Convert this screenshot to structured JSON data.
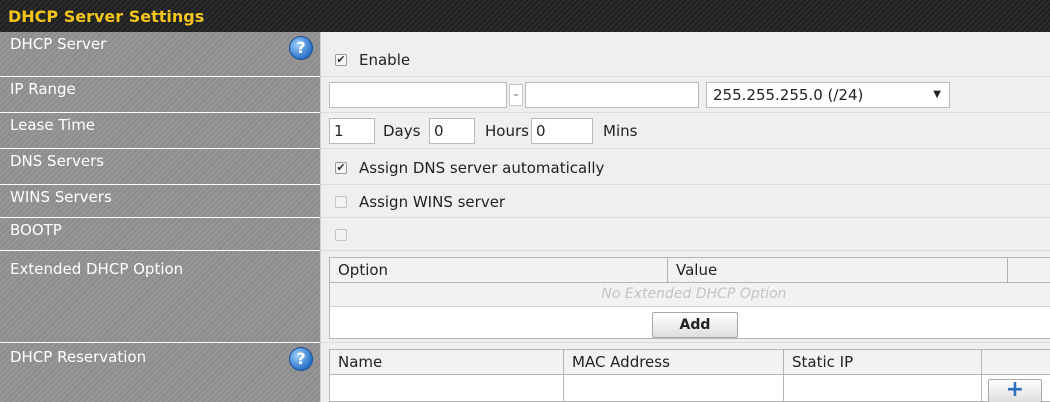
{
  "section": {
    "title": "DHCP Server Settings"
  },
  "rows": {
    "dhcp_server": {
      "label": "DHCP Server",
      "checkbox_label": "Enable",
      "checked": true,
      "help": "?"
    },
    "ip_range": {
      "label": "IP Range",
      "start_value": "",
      "end_value": "",
      "separator": "-",
      "subnet": "255.255.255.0 (/24)"
    },
    "lease_time": {
      "label": "Lease Time",
      "days": "1",
      "days_label": "Days",
      "hours": "0",
      "hours_label": "Hours",
      "mins": "0",
      "mins_label": "Mins"
    },
    "dns_servers": {
      "label": "DNS Servers",
      "checkbox_label": "Assign DNS server automatically",
      "checked": true
    },
    "wins_servers": {
      "label": "WINS Servers",
      "checkbox_label": "Assign WINS server",
      "checked": false
    },
    "bootp": {
      "label": "BOOTP",
      "checked": false
    },
    "extended_option": {
      "label": "Extended DHCP Option",
      "columns": [
        "Option",
        "Value"
      ],
      "empty_text": "No Extended DHCP Option",
      "add_label": "Add"
    },
    "reservation": {
      "label": "DHCP Reservation",
      "help": "?",
      "columns": [
        "Name",
        "MAC Address",
        "Static IP"
      ],
      "add_icon": "+"
    }
  },
  "colors": {
    "header_text": "#f3c61b",
    "label_bg": "#8d8d8d",
    "value_bg": "#efefef"
  }
}
